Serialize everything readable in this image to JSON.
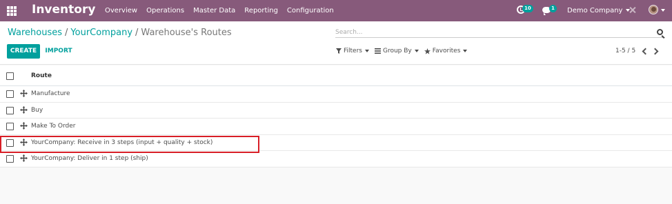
{
  "navbar": {
    "app_name": "Inventory",
    "menu": [
      "Overview",
      "Operations",
      "Master Data",
      "Reporting",
      "Configuration"
    ],
    "activity_count": "10",
    "message_count": "1",
    "company": "Demo Company",
    "bg_color": "#875a7b"
  },
  "breadcrumb": {
    "items": [
      "Warehouses",
      "YourCompany",
      "Warehouse's Routes"
    ],
    "separator": "/"
  },
  "actions": {
    "create_label": "CREATE",
    "import_label": "IMPORT"
  },
  "search": {
    "placeholder": "Search...",
    "value": ""
  },
  "filters": {
    "filters_label": "Filters",
    "group_by_label": "Group By",
    "favorites_label": "Favorites"
  },
  "pager": {
    "text": "1-5 / 5"
  },
  "list": {
    "column_header": "Route",
    "rows": [
      "Manufacture",
      "Buy",
      "Make To Order",
      "YourCompany: Receive in 3 steps (input + quality + stock)",
      "YourCompany: Deliver in 1 step (ship)"
    ],
    "highlighted_row": "YourCompany: Receive in 3 steps (input + quality + stock)"
  },
  "colors": {
    "primary": "#00a09d",
    "highlight_border": "#d81e26"
  }
}
